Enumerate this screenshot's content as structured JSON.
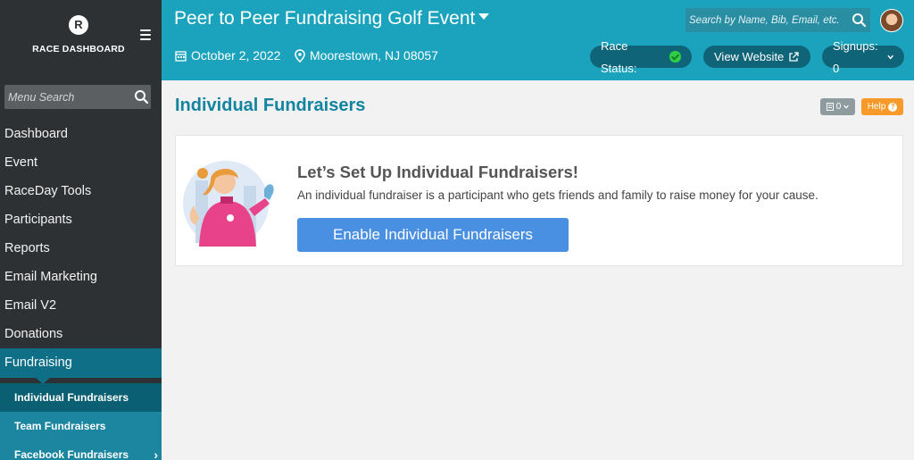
{
  "sidebar": {
    "brand_letter": "R",
    "brand_label": "RACE DASHBOARD",
    "search_placeholder": "Menu Search",
    "items": [
      {
        "label": "Dashboard"
      },
      {
        "label": "Event"
      },
      {
        "label": "RaceDay Tools"
      },
      {
        "label": "Participants"
      },
      {
        "label": "Reports"
      },
      {
        "label": "Email Marketing"
      },
      {
        "label": "Email V2"
      },
      {
        "label": "Donations"
      },
      {
        "label": "Fundraising"
      }
    ],
    "subitems": [
      {
        "label": "Individual Fundraisers"
      },
      {
        "label": "Team Fundraisers"
      },
      {
        "label": "Facebook Fundraisers"
      }
    ]
  },
  "header": {
    "event_title": "Peer to Peer Fundraising Golf Event",
    "search_placeholder": "Search by Name, Bib, Email, etc.",
    "date": "October 2, 2022",
    "location": "Moorestown, NJ 08057",
    "race_status_label": "Race Status:",
    "view_website_label": "View Website",
    "signups_label": "Signups: 0"
  },
  "main": {
    "page_title": "Individual Fundraisers",
    "count_label": "0",
    "help_label": "Help",
    "card": {
      "title": "Let’s Set Up Individual Fundraisers!",
      "description": "An individual fundraiser is a participant who gets friends and family to raise money for your cause.",
      "button_label": "Enable Individual Fundraisers"
    }
  },
  "colors": {
    "sidebar_bg": "#2e3134",
    "header_bg": "#1ba3bd",
    "active_nav": "#0e6f87",
    "subnav_bg": "#1c86a1",
    "primary_button": "#4a90e2",
    "help_button": "#f79a2a",
    "status_ok": "#2fd045"
  },
  "icons": {
    "brand": "race-logo-icon",
    "menu": "hamburger-icon",
    "search": "search-icon",
    "calendar": "calendar-icon",
    "location": "map-pin-icon",
    "external": "external-link-icon",
    "status": "check-circle-icon"
  }
}
